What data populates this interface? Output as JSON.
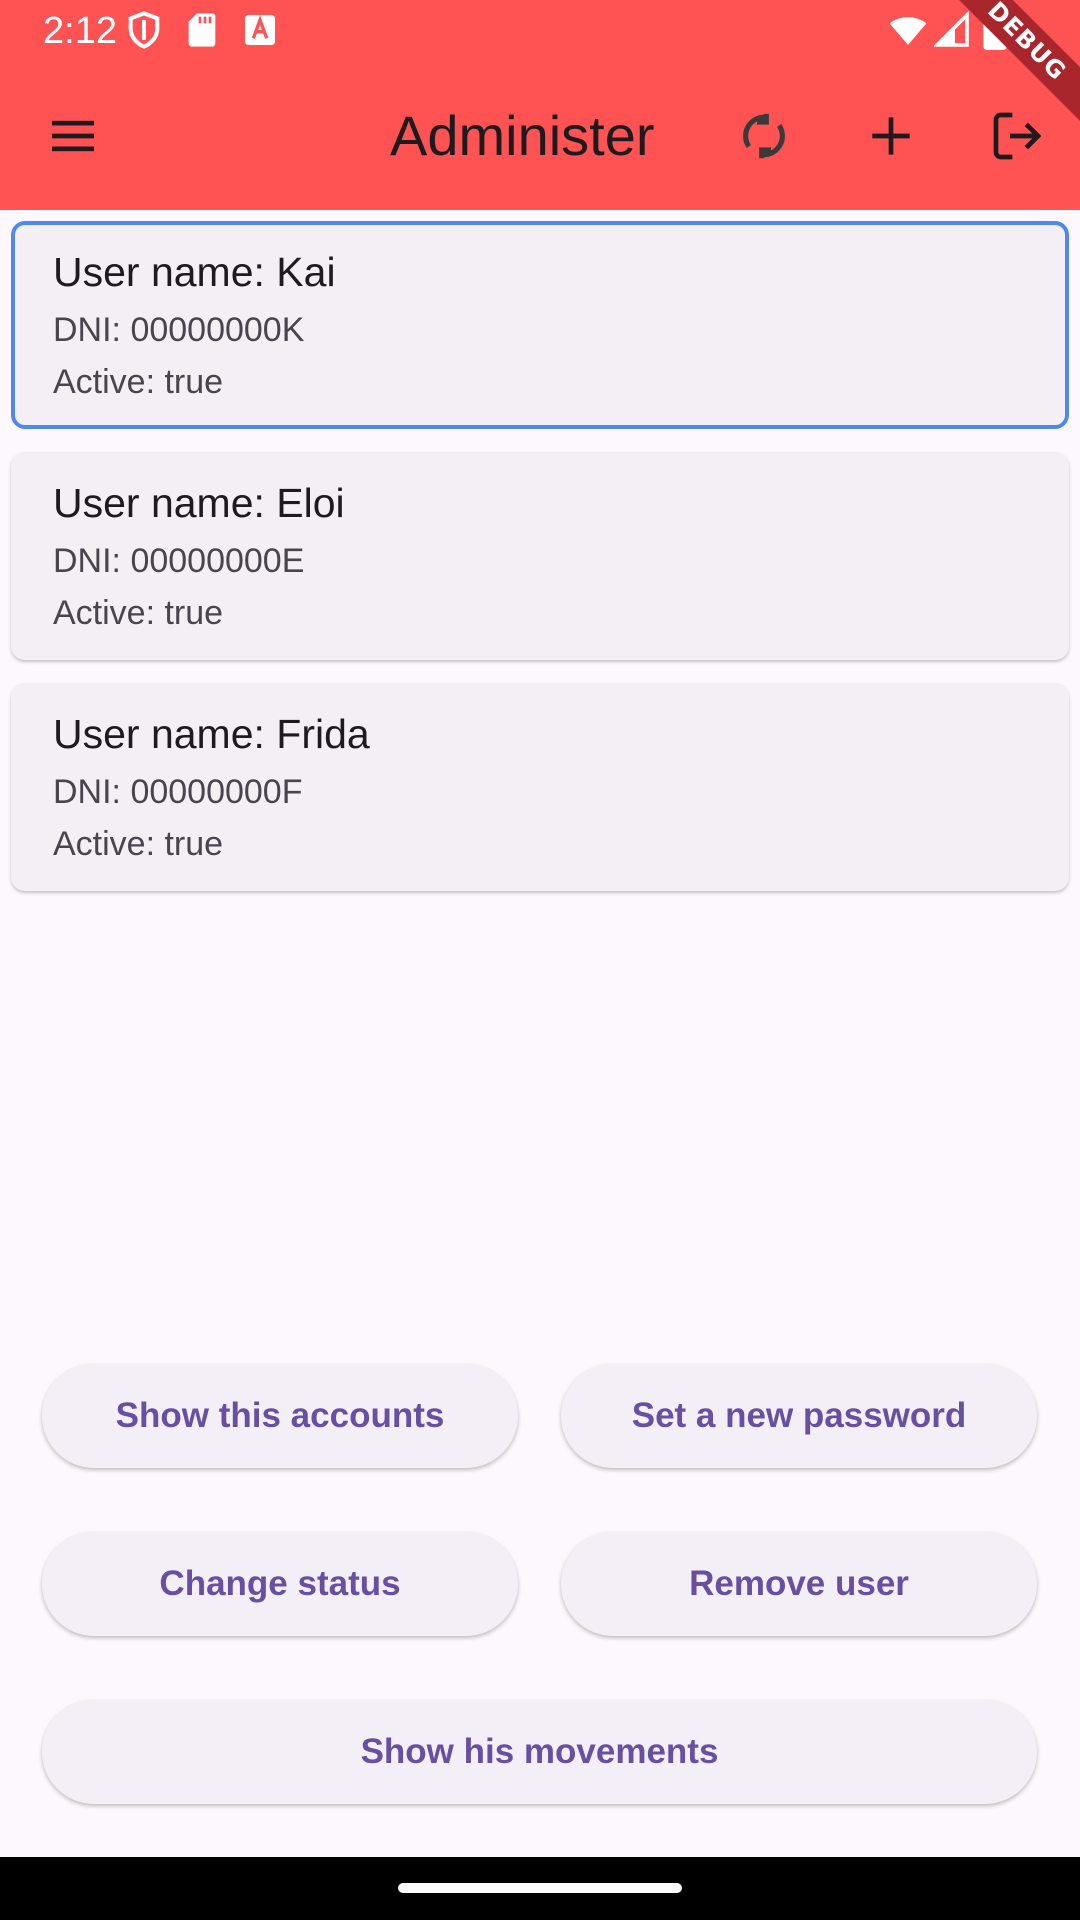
{
  "status_bar": {
    "time": "2:12",
    "icons": [
      "shield-icon",
      "sd-card-icon",
      "font-download-icon",
      "wifi-icon",
      "signal-icon",
      "battery-icon"
    ]
  },
  "app_bar": {
    "title": "Administer",
    "debug_banner": "DEBUG",
    "background_color": "#ff5252",
    "icons": [
      "menu-icon",
      "refresh-icon",
      "add-icon",
      "logout-icon"
    ]
  },
  "users": [
    {
      "name": "User name: Kai",
      "dni": "DNI: 00000000K",
      "active": "Active: true",
      "selected": true
    },
    {
      "name": "User name: Eloi",
      "dni": "DNI: 00000000E",
      "active": "Active: true",
      "selected": false
    },
    {
      "name": "User name: Frida",
      "dni": "DNI: 00000000F",
      "active": "Active: true",
      "selected": false
    }
  ],
  "actions": {
    "show_accounts": "Show this accounts",
    "set_password": "Set a new password",
    "change_status": "Change status",
    "remove_user": "Remove user",
    "show_movements": "Show his movements"
  },
  "colors": {
    "accent": "#6750a4",
    "selected_border": "#4f88ee",
    "card_background": "#f4eff4",
    "page_background": "#fdf8fd"
  }
}
